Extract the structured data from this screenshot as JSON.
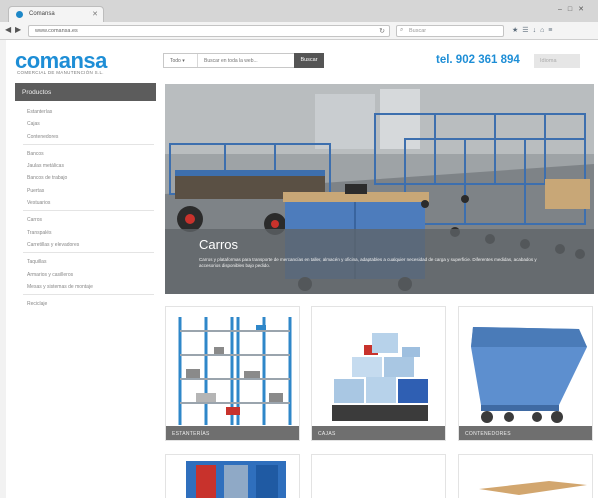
{
  "browser": {
    "tab_title": "Comansa",
    "url": "www.comansa.es",
    "search_placeholder": "Buscar"
  },
  "header": {
    "logo": "comansa",
    "tagline": "COMERCIAL DE MANUTENCIÓN S.L.",
    "search_select": "Todo",
    "search_placeholder": "Buscar en toda la web...",
    "search_button": "Buscar",
    "phone": "tel. 902 361 894",
    "language": "Idioma"
  },
  "sidebar": {
    "title": "Productos",
    "groups": [
      [
        "Estanterías",
        "Cajas",
        "Contenedores"
      ],
      [
        "Bancos",
        "Jaulas metálicas",
        "Bancos de trabajo",
        "Puertas",
        "Vestuarios"
      ],
      [
        "Carros",
        "Transpalés",
        "Carretillas y elevadores"
      ],
      [
        "Taquillas",
        "Armarios y casilleros",
        "Mesas y sistemas de montaje"
      ],
      [
        "Reciclaje"
      ]
    ]
  },
  "hero": {
    "title": "Carros",
    "text": "Carros y plataformas para transporte de mercancías en taller, almacén y oficina, adaptables a cualquier necesidad de carga y superficie. Diferentes medidas, acabados y accesorios disponibles bajo pedido."
  },
  "cards": [
    {
      "label": "ESTANTERÍAS"
    },
    {
      "label": "CAJAS"
    },
    {
      "label": "CONTENEDORES"
    }
  ],
  "colors": {
    "brand_blue": "#1e8ed6",
    "sidebar_head": "#5c5c5c",
    "card_label": "#6f6f6f"
  }
}
